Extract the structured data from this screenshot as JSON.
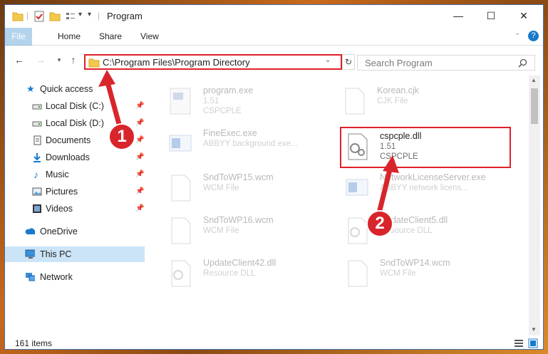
{
  "title_bar": {
    "title": "Program",
    "minimize": "—",
    "maximize": "☐",
    "close": "✕"
  },
  "ribbon": {
    "tabs": [
      "File",
      "Home",
      "Share",
      "View"
    ],
    "help": "?"
  },
  "navigation": {
    "address": "C:\\Program Files\\Program Directory",
    "search_placeholder": "Search Program"
  },
  "sidebar": {
    "items": [
      {
        "label": "Quick access",
        "icon": "star-icon",
        "pinned": false
      },
      {
        "label": "Local Disk (C:)",
        "icon": "disk-icon",
        "pinned": true
      },
      {
        "label": "Local Disk (D:)",
        "icon": "disk-icon",
        "pinned": true
      },
      {
        "label": "Documents",
        "icon": "documents-icon",
        "pinned": true
      },
      {
        "label": "Downloads",
        "icon": "download-icon",
        "pinned": true
      },
      {
        "label": "Music",
        "icon": "music-icon",
        "pinned": true
      },
      {
        "label": "Pictures",
        "icon": "pictures-icon",
        "pinned": true
      },
      {
        "label": "Videos",
        "icon": "videos-icon",
        "pinned": true
      },
      {
        "label": "OneDrive",
        "icon": "cloud-icon",
        "pinned": false
      },
      {
        "label": "This PC",
        "icon": "computer-icon",
        "pinned": false
      },
      {
        "label": "Network",
        "icon": "network-icon",
        "pinned": false
      }
    ]
  },
  "files": [
    {
      "name": "program.exe",
      "line2": "1.51",
      "line3": "CSPCPLE"
    },
    {
      "name": "Korean.cjk",
      "line2": "CJK File",
      "line3": ""
    },
    {
      "name": "FineExec.exe",
      "line2": "ABBYY background exe...",
      "line3": ""
    },
    {
      "name": "cspcple.dll",
      "line2": "1.51",
      "line3": "CSPCPLE"
    },
    {
      "name": "SndToWP15.wcm",
      "line2": "WCM File",
      "line3": ""
    },
    {
      "name": "NetworkLicenseServer.exe",
      "line2": "ABBYY network licens...",
      "line3": ""
    },
    {
      "name": "SndToWP16.wcm",
      "line2": "WCM File",
      "line3": ""
    },
    {
      "name": "UpdateClient5.dll",
      "line2": "Resource DLL",
      "line3": ""
    },
    {
      "name": "UpdateClient42.dll",
      "line2": "Resource DLL",
      "line3": ""
    },
    {
      "name": "SndToWP14.wcm",
      "line2": "WCM File",
      "line3": ""
    }
  ],
  "status": {
    "item_count": "161 items"
  },
  "callouts": [
    "1",
    "2"
  ],
  "colors": {
    "accent": "#1979ca",
    "highlight": "#e0202a",
    "selected": "#cce4f7"
  }
}
